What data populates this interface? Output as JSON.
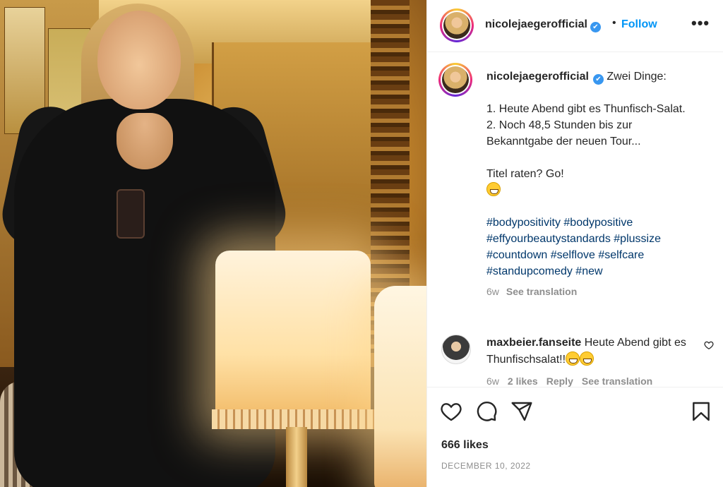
{
  "post": {
    "username": "nicolejaegerofficial",
    "verified_mark": "✔",
    "dot": "•",
    "follow_label": "Follow",
    "more_label": "•••",
    "photo_icon": "photo",
    "caption": {
      "intro": "Zwei Dinge:",
      "line1": "1. Heute Abend gibt es Thunfisch-Salat.",
      "line2": "2. Noch 48,5 Stunden bis zur Bekanntgabe der neuen Tour...",
      "line3": "Titel raten? Go!",
      "emoji": "grinning-face-icon",
      "hashtags": "#bodypositivity #bodypositive #effyourbeautystandards #plussize #countdown #selflove #selfcare #standupcomedy #new",
      "time": "6w",
      "see_translation": "See translation"
    },
    "comment": {
      "username": "maxbeier.fanseite",
      "text": "Heute Abend gibt es Thunfischsalat!!",
      "emojis": [
        "laughing-face-icon",
        "grinning-face-icon"
      ],
      "time": "6w",
      "likes": "2 likes",
      "reply": "Reply",
      "see_translation": "See translation",
      "like_icon": "heart-outline-icon"
    },
    "actions": {
      "icons": [
        "heart-icon",
        "comment-icon",
        "share-icon",
        "bookmark-icon"
      ]
    },
    "likes": "666 likes",
    "date": "DECEMBER 10, 2022"
  }
}
